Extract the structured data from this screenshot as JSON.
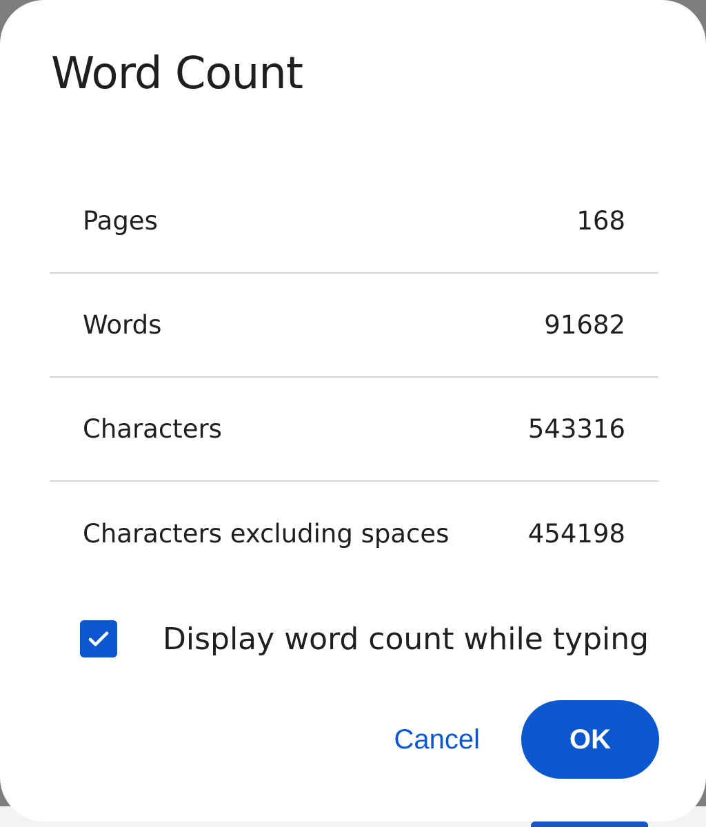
{
  "dialog": {
    "title": "Word Count",
    "stats": [
      {
        "label": "Pages",
        "value": "168"
      },
      {
        "label": "Words",
        "value": "91682"
      },
      {
        "label": "Characters",
        "value": "543316"
      },
      {
        "label": "Characters excluding spaces",
        "value": "454198"
      }
    ],
    "display_while_typing": {
      "label": "Display word count while typing",
      "checked": true
    },
    "cancel_label": "Cancel",
    "ok_label": "OK"
  },
  "colors": {
    "accent": "#0b57d0",
    "text": "#1f1f1f",
    "divider": "#d2d6dc"
  }
}
